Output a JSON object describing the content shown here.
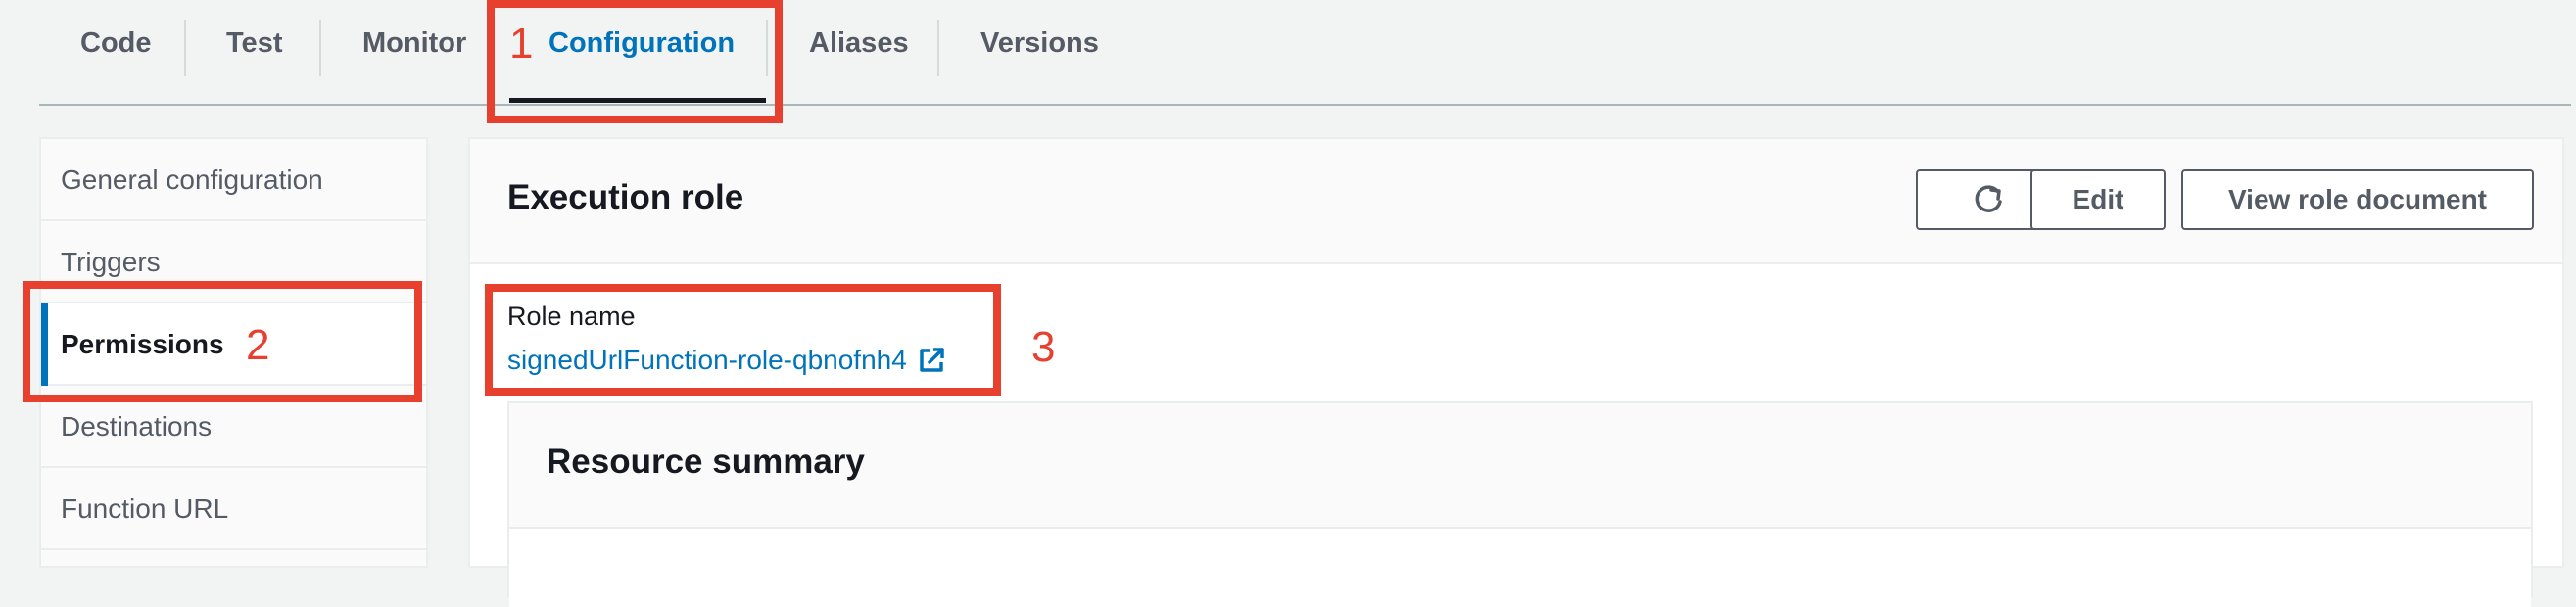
{
  "tabs": [
    {
      "label": "Code"
    },
    {
      "label": "Test"
    },
    {
      "label": "Monitor"
    },
    {
      "label": "Configuration",
      "active": true
    },
    {
      "label": "Aliases"
    },
    {
      "label": "Versions"
    }
  ],
  "sidebar": {
    "items": [
      {
        "label": "General configuration"
      },
      {
        "label": "Triggers"
      },
      {
        "label": "Permissions",
        "active": true
      },
      {
        "label": "Destinations"
      },
      {
        "label": "Function URL"
      }
    ]
  },
  "execution_role": {
    "title": "Execution role",
    "refresh_icon": "refresh-icon",
    "edit_label": "Edit",
    "view_document_label": "View role document",
    "role_name_label": "Role name",
    "role_name_value": "signedUrlFunction-role-qbnofnh4",
    "external_link_icon": "external-link-icon"
  },
  "resource_summary": {
    "title": "Resource summary"
  },
  "annotations": {
    "step1": "1",
    "step2": "2",
    "step3": "3",
    "color": "#e8402f"
  },
  "colors": {
    "accent": "#0073bb",
    "text": "#16191f",
    "muted": "#545b64"
  }
}
